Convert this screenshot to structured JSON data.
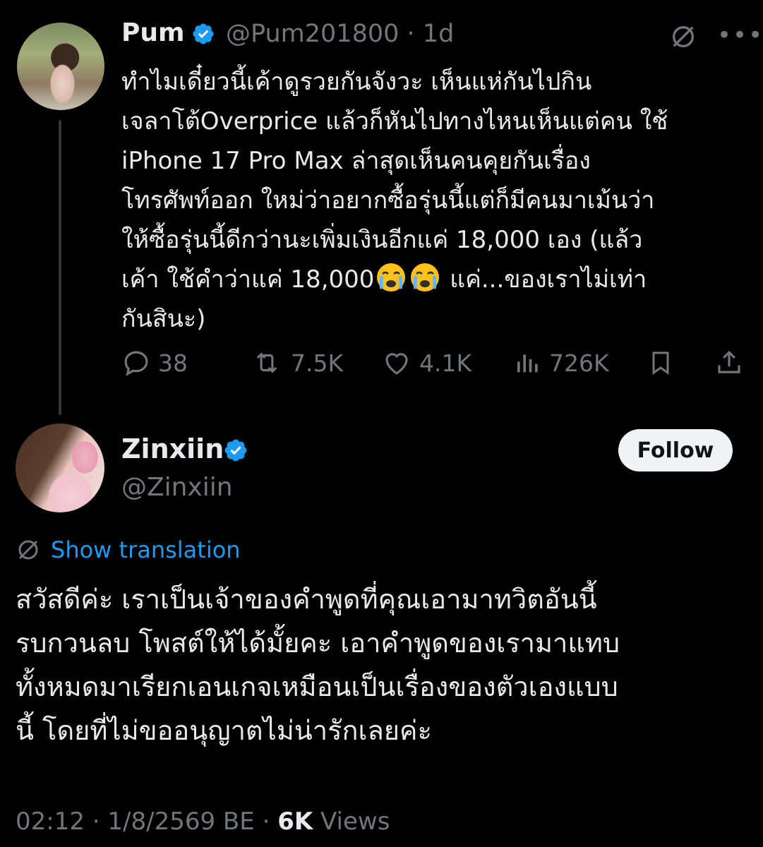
{
  "parent_tweet": {
    "display_name": "Pum",
    "handle": "@Pum201800",
    "separator": "·",
    "time_ago": "1d",
    "text": "ทำไมเดี๋ยวนี้เค้าดูรวยกันจังวะ เห็นแห่กันไปกิน\nเจลาโต้Overprice แล้วก็หันไปทางไหนเห็นแต่คน ใช้\niPhone 17 Pro Max ล่าสุดเห็นคนคุยกันเรื่อง\nโทรศัพท์ออก ใหม่ว่าอยากซื้อรุ่นนี้แต่ก็มีคนมาเม้นว่า\nให้ซื้อรุ่นนี้ดีกว่านะเพิ่มเงินอีกแค่ 18,000 เอง (แล้ว\nเค้า ใช้คำว่าแค่ 18,000",
    "text_after_emoji": " แค่...ของเราไม่เท่า\nกันสินะ)",
    "emoji": "loudly-crying-face",
    "actions": {
      "replies": "38",
      "reposts": "7.5K",
      "likes": "4.1K",
      "views": "726K"
    }
  },
  "reply_tweet": {
    "display_name": "Zinxiin",
    "handle": "@Zinxiin",
    "follow_label": "Follow",
    "translation_label": "Show translation",
    "text": "สวัสดีค่ะ เราเป็นเจ้าของคำพูดที่คุณเอามาทวิตอันนี้\nรบกวนลบ โพสต์ให้ได้มั้ยคะ เอาคำพูดของเรามาแทบ\nทั้งหมดมาเรียกเอนเกจเหมือนเป็นเรื่องของตัวเองแบบ\nนี้ โดยที่ไม่ขออนุญาตไม่น่ารักเลยค่ะ",
    "time": "02:12",
    "date": "1/8/2569 BE",
    "separator": "·",
    "views_count": "6K",
    "views_label": "Views"
  },
  "colors": {
    "background": "#000000",
    "text_primary": "#e7e9ea",
    "text_secondary": "#71767b",
    "accent_blue": "#1d9bf0",
    "follow_button_bg": "#eff3f4"
  },
  "icons": [
    "verified-badge-icon",
    "grok-icon",
    "more-icon",
    "reply-icon",
    "repost-icon",
    "like-icon",
    "views-icon",
    "bookmark-icon",
    "share-icon",
    "translate-icon"
  ]
}
